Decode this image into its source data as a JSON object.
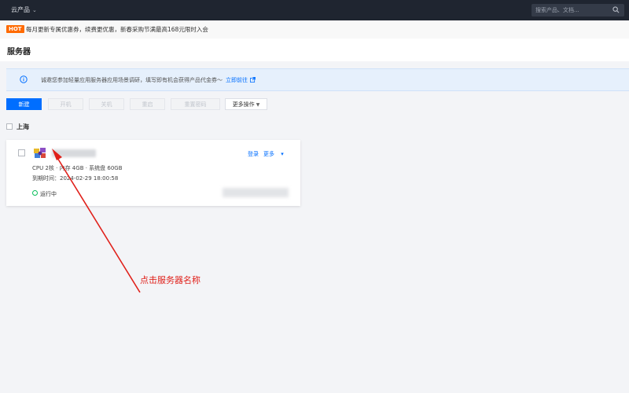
{
  "topbar": {
    "product_menu": "云产品",
    "search_placeholder": "搜索产品、文档..."
  },
  "promo": {
    "badge": "HOT",
    "message": "每月更新专属优惠券，续费更优惠，新春采购节满最高168元限时入会"
  },
  "page": {
    "title": "服务器"
  },
  "notice": {
    "text": "诚邀您参加轻量应用服务器应用场景调研，填写即有机会获得产品代金券～",
    "link": "立即前往"
  },
  "toolbar": {
    "new": "新建",
    "start": "开机",
    "stop": "关机",
    "restart": "重启",
    "reset_password": "重置密码",
    "more_ops": "更多操作"
  },
  "region": {
    "label": "上海"
  },
  "server": {
    "spec": "CPU 2核 · 内存 4GB · 系统盘 60GB",
    "expire_label": "到期时间：",
    "expire_value": "2024-02-29 18:00:58",
    "status": "运行中",
    "login": "登录",
    "more": "更多"
  },
  "annotation": {
    "text": "点击服务器名称",
    "color": "#e0201a"
  },
  "colors": {
    "primary": "#006eff",
    "topbar": "#1f2530",
    "running": "#0abf5b",
    "hot": "#ff6a00"
  }
}
